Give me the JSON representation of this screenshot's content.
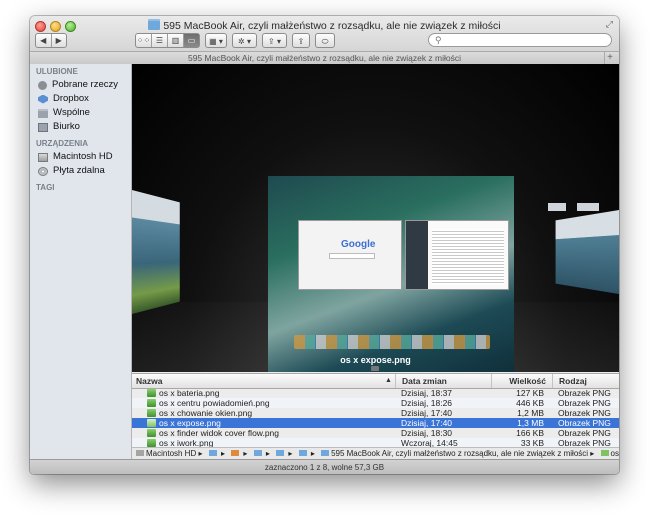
{
  "window": {
    "title": "595 MacBook Air, czyli małżeństwo z rozsądku, ale nie związek z miłości",
    "path_title": "595 MacBook Air, czyli małżeństwo z rozsądku, ale nie związek z miłości"
  },
  "toolbar": {
    "nav_back": "◀",
    "nav_forward": "▶",
    "view_modes": [
      "⁘⁘",
      "☰",
      "▥",
      "▭"
    ],
    "arrange": "▦ ▾",
    "action": "✲ ▾",
    "dropbox": "⇪ ▾",
    "share": "⇪",
    "tags": "⬭",
    "search_placeholder": ""
  },
  "sidebar": {
    "sections": [
      {
        "title": "ULUBIONE",
        "items": [
          {
            "label": "Pobrane rzeczy",
            "icon": "downloads-icon"
          },
          {
            "label": "Dropbox",
            "icon": "dropbox-icon"
          },
          {
            "label": "Wspólne",
            "icon": "shared-folder-icon"
          },
          {
            "label": "Biurko",
            "icon": "desktop-icon"
          }
        ]
      },
      {
        "title": "URZĄDZENIA",
        "items": [
          {
            "label": "Macintosh HD",
            "icon": "hard-disk-icon"
          },
          {
            "label": "Płyta zdalna",
            "icon": "remote-disc-icon"
          }
        ]
      },
      {
        "title": "TAGI",
        "items": []
      }
    ]
  },
  "coverflow": {
    "selected_label": "os x expose.png",
    "google_logo": "Google"
  },
  "list": {
    "columns": {
      "name": "Nazwa",
      "date": "Data zmian",
      "size": "Wielkość",
      "kind": "Rodzaj"
    },
    "sort_indicator": "▲",
    "rows": [
      {
        "name": "os x bateria.png",
        "date": "Dzisiaj, 18:37",
        "size": "127 KB",
        "kind": "Obrazek PNG"
      },
      {
        "name": "os x centru powiadomień.png",
        "date": "Dzisiaj, 18:26",
        "size": "446 KB",
        "kind": "Obrazek PNG"
      },
      {
        "name": "os x chowanie okien.png",
        "date": "Dzisiaj, 17:40",
        "size": "1,2 MB",
        "kind": "Obrazek PNG"
      },
      {
        "name": "os x expose.png",
        "date": "Dzisiaj, 17:40",
        "size": "1,3 MB",
        "kind": "Obrazek PNG",
        "selected": true
      },
      {
        "name": "os x finder widok cover flow.png",
        "date": "Dzisiaj, 18:30",
        "size": "166 KB",
        "kind": "Obrazek PNG"
      },
      {
        "name": "os x iwork.png",
        "date": "Wczoraj, 14:45",
        "size": "33 KB",
        "kind": "Obrazek PNG"
      }
    ]
  },
  "pathbar": {
    "segments": [
      "Macintosh HD",
      "",
      "",
      "",
      "",
      "",
      "595 MacBook Air, czyli małżeństwo z rozsądku, ale nie związek z miłości",
      "os x expose.png"
    ]
  },
  "status": {
    "text": "zaznaczono 1 z 8, wolne 57,3 GB"
  },
  "colors": {
    "selection": "#3a74d6",
    "sidebar_bg": "#e1e6ed"
  }
}
